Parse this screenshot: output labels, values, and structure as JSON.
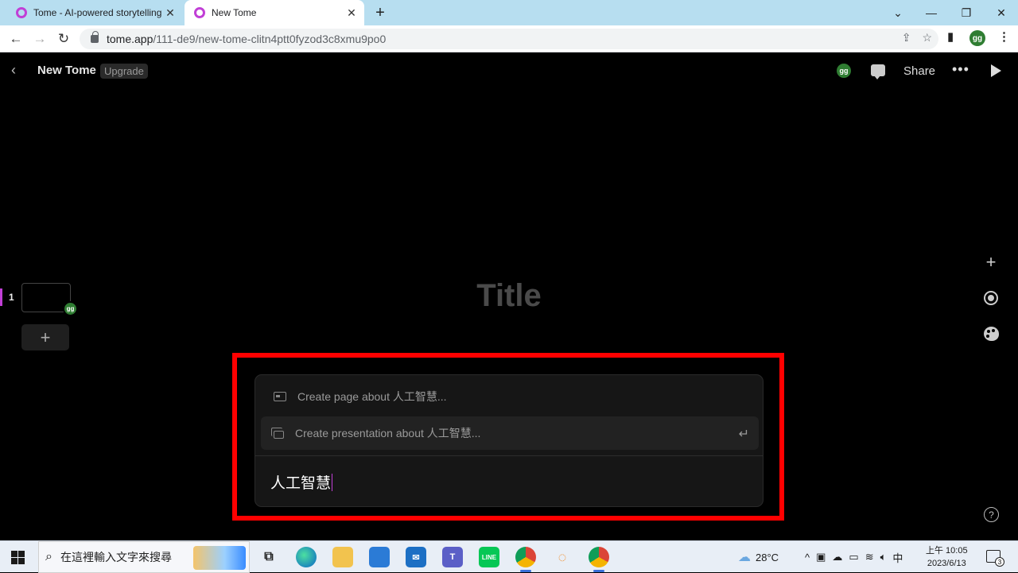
{
  "browser": {
    "tabs": [
      {
        "title": "Tome - AI-powered storytelling",
        "active": false
      },
      {
        "title": "New Tome",
        "active": true
      }
    ],
    "new_tab": "+",
    "window_controls": {
      "tab_search": "⌄",
      "minimize": "—",
      "restore": "❐",
      "close": "✕"
    },
    "url": {
      "host": "tome.app",
      "path": "/111-de9/new-tome-clitn4ptt0fyzod3c8xmu9po0"
    },
    "profile_avatar": "gg"
  },
  "app": {
    "title": "New Tome",
    "upgrade_label": "Upgrade",
    "user_avatar": "gg",
    "share_label": "Share",
    "more_label": "•••"
  },
  "pages_panel": {
    "pages": [
      {
        "number": "1",
        "avatar": "gg"
      }
    ],
    "add_label": "+"
  },
  "canvas": {
    "title_placeholder": "Title"
  },
  "right_toolbar": {
    "add_label": "+",
    "help_label": "?"
  },
  "prompt": {
    "suggestions": [
      {
        "label": "Create page about 人工智慧...",
        "icon": "page-icon"
      },
      {
        "label": "Create presentation about 人工智慧...",
        "icon": "presentation-icon",
        "selected": true
      }
    ],
    "enter_glyph": "↵",
    "input_value": "人工智慧"
  },
  "highlight_color": "#ff0000",
  "accent_color": "#c13fd6",
  "taskbar": {
    "search_placeholder": "在這裡輸入文字來搜尋",
    "weather": "28°C",
    "ime": "中",
    "time": "上午 10:05",
    "date": "2023/6/13",
    "notification_count": "3"
  }
}
